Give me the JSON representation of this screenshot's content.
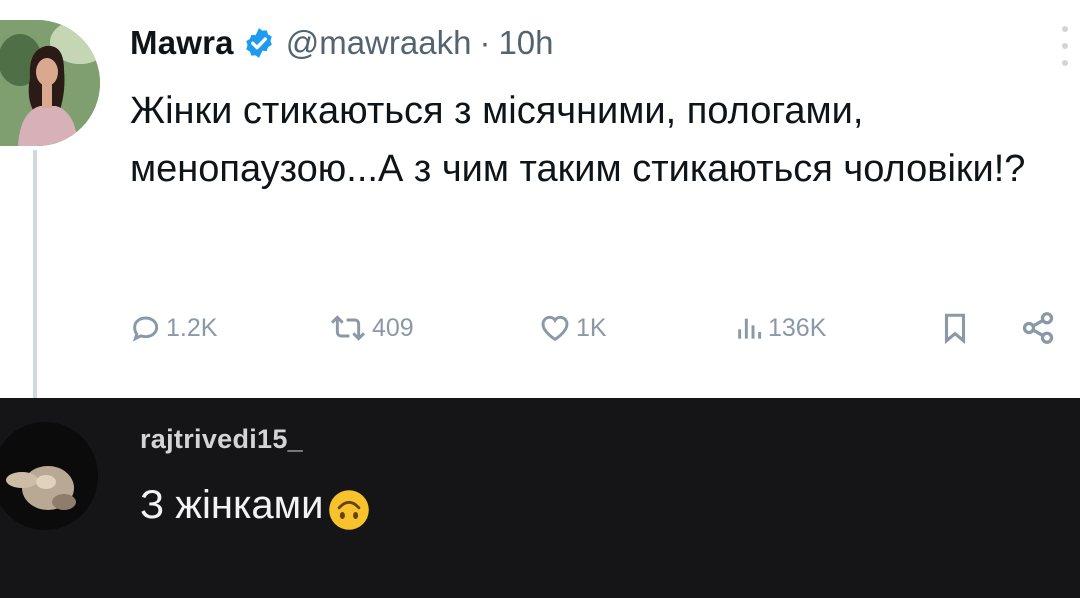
{
  "tweet": {
    "display_name": "Mawra",
    "handle": "@mawraakh",
    "separator": "·",
    "time": "10h",
    "text": "Жінки стикаються з місячними, пологами, менопаузою...А з чим таким стикаються чоловіки!?",
    "actions": {
      "reply_count": "1.2K",
      "retweet_count": "409",
      "like_count": "1K",
      "views_count": "136K"
    },
    "icons": [
      "verified-badge-icon",
      "more-icon",
      "reply-icon",
      "retweet-icon",
      "like-icon",
      "views-icon",
      "bookmark-icon",
      "share-icon"
    ]
  },
  "reply": {
    "username": "rajtrivedi15_",
    "text": "З жінками",
    "emoji": "upside-down-face-emoji"
  },
  "colors": {
    "tweet_background": "#ffffff",
    "reply_background": "#151518",
    "verified_blue": "#1d9bf0",
    "secondary_text": "#536471"
  }
}
